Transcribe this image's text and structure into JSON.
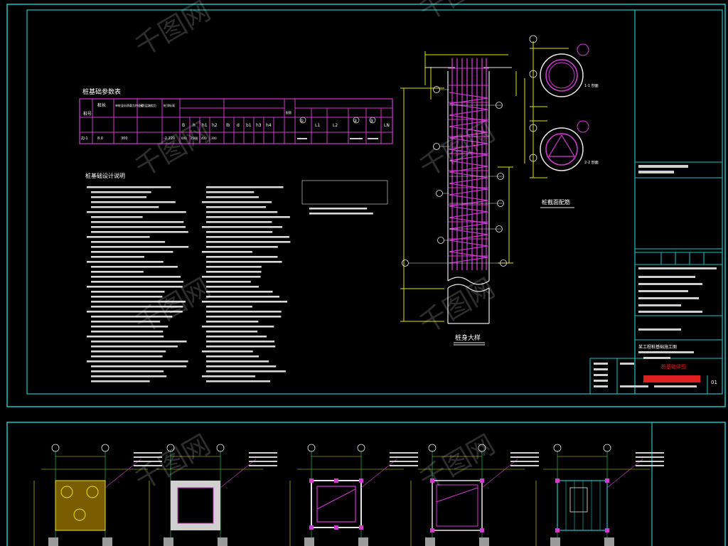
{
  "upper_sheet": {
    "table_title": "桩基础参数表",
    "table": {
      "header_row1": [
        "桩号",
        "桩长",
        "单桩竖向承载力特征值",
        "持力层端阻力",
        "桩顶标高",
        "B",
        "h",
        "h1",
        "h2",
        "lb",
        "d",
        "b1",
        "h3",
        "h4",
        "配筋",
        "①",
        "L1",
        "L2",
        "②",
        "③",
        "LN"
      ],
      "row1": [
        "ZJ-1",
        "8.0",
        "300",
        "",
        "-2.220",
        "600",
        "2500",
        "400",
        "300"
      ],
      "row2": [
        "",
        "",
        "",
        "",
        "",
        "",
        "",
        "",
        "",
        "",
        "",
        "",
        "",
        "",
        "",
        "",
        "",
        "",
        "",
        "",
        ""
      ]
    },
    "notes_title": "桩基础设计说明",
    "column_caption": "桩身大样",
    "section_caption": "桩截面配筋",
    "section_labels": [
      "1-1 剖面",
      "2-2 剖面"
    ],
    "title_block": {
      "project": "某工程桩基础施工图",
      "drawing_title": "桩基础详图",
      "stamp_line": "1-1 工程图",
      "sheet_no": "01"
    }
  },
  "lower_sheet": {
    "plan_count": 5
  },
  "watermark": "千图网",
  "colors": {
    "border": "#19c6c6",
    "rebar": "#d23ad2",
    "dimension": "#e6e600",
    "text": "#ffffff",
    "stamp": "#e02020"
  }
}
